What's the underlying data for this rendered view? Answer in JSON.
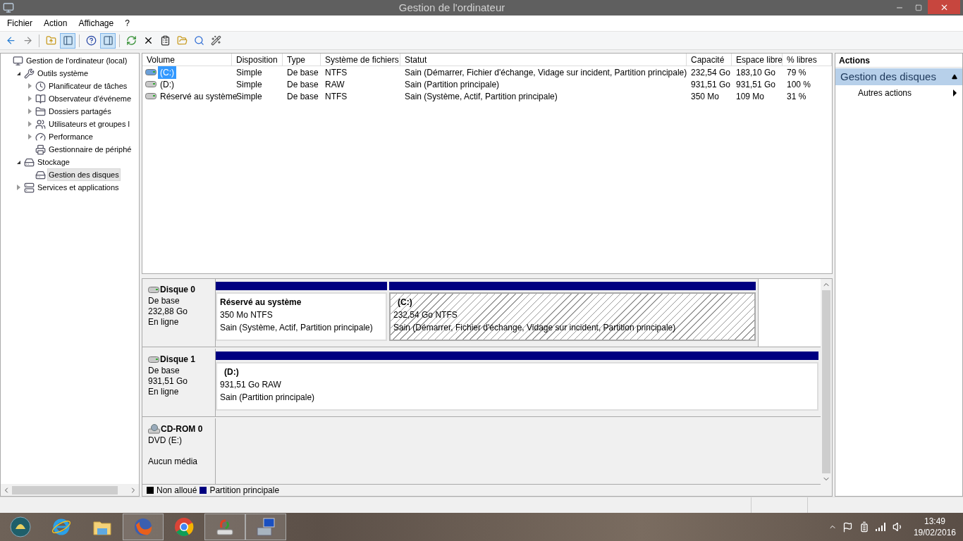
{
  "window": {
    "title": "Gestion de l'ordinateur"
  },
  "menu": [
    "Fichier",
    "Action",
    "Affichage",
    "?"
  ],
  "toolbar": [
    {
      "pressed": false
    },
    {
      "pressed": false
    },
    {
      "pressed": false
    },
    {
      "pressed": true
    },
    {
      "pressed": false
    },
    {
      "pressed": true
    },
    {
      "pressed": false
    },
    {
      "pressed": false
    },
    {
      "pressed": false
    },
    {
      "pressed": false
    },
    {
      "pressed": false
    },
    {
      "pressed": false
    }
  ],
  "tree": [
    {
      "label": "Gestion de l'ordinateur (local)",
      "selected": false,
      "children": [
        {
          "label": "Outils système",
          "expanded": true,
          "selected": false,
          "children": [
            {
              "label": "Planificateur de tâches",
              "expanded": false,
              "selected": false
            },
            {
              "label": "Observateur d'événeme",
              "expanded": false,
              "selected": false
            },
            {
              "label": "Dossiers partagés",
              "expanded": false,
              "selected": false
            },
            {
              "label": "Utilisateurs et groupes l",
              "expanded": false,
              "selected": false
            },
            {
              "label": "Performance",
              "expanded": false,
              "selected": false
            },
            {
              "label": "Gestionnaire de périphé",
              "selected": false
            }
          ]
        },
        {
          "label": "Stockage",
          "expanded": true,
          "selected": false,
          "children": [
            {
              "label": "Gestion des disques",
              "selected": true
            }
          ]
        },
        {
          "label": "Services et applications",
          "expanded": false,
          "selected": false
        }
      ]
    }
  ],
  "volumes": {
    "columns": [
      "Volume",
      "Disposition",
      "Type",
      "Système de fichiers",
      "Statut",
      "Capacité",
      "Espace libre",
      "% libres"
    ],
    "rows": [
      {
        "selected": true,
        "cells": [
          "(C:)",
          "Simple",
          "De base",
          "NTFS",
          "Sain (Démarrer, Fichier d'échange, Vidage sur incident, Partition principale)",
          "232,54 Go",
          "183,10 Go",
          "79 %"
        ]
      },
      {
        "selected": false,
        "cells": [
          "(D:)",
          "Simple",
          "De base",
          "RAW",
          "Sain (Partition principale)",
          "931,51 Go",
          "931,51 Go",
          "100 %"
        ]
      },
      {
        "selected": false,
        "cells": [
          "Réservé au système",
          "Simple",
          "De base",
          "NTFS",
          "Sain (Système, Actif, Partition principale)",
          "350 Mo",
          "109 Mo",
          "31 %"
        ]
      }
    ]
  },
  "disks": [
    {
      "kind": "disk",
      "name": "Disque 0",
      "lines": [
        "De base",
        "232,88 Go",
        "En ligne"
      ],
      "partitions": [
        {
          "name": "Réservé au système",
          "size": "350 Mo NTFS",
          "status": "Sain (Système, Actif, Partition principale)",
          "selected": false
        },
        {
          "name": "(C:)",
          "size": "232,54 Go NTFS",
          "status": "Sain (Démarrer, Fichier d'échange, Vidage sur incident, Partition principale)",
          "selected": true
        }
      ]
    },
    {
      "kind": "disk",
      "name": "Disque 1",
      "lines": [
        "De base",
        "931,51 Go",
        "En ligne"
      ],
      "partitions": [
        {
          "name": "(D:)",
          "size": "931,51 Go RAW",
          "status": "Sain (Partition principale)",
          "selected": false
        }
      ]
    },
    {
      "kind": "cdrom",
      "name": "CD-ROM 0",
      "lines": [
        "DVD (E:)"
      ],
      "note": "Aucun média"
    }
  ],
  "legend": [
    {
      "label": "Non alloué",
      "color": "#000000"
    },
    {
      "label": "Partition principale",
      "color": "#000080"
    }
  ],
  "actions": {
    "title": "Actions",
    "section": "Gestion des disques",
    "items": [
      "Autres actions"
    ]
  },
  "taskbar": {
    "apps": [
      {
        "running": false
      },
      {
        "running": false
      },
      {
        "running": false
      },
      {
        "running": true
      },
      {
        "running": false
      },
      {
        "running": true
      },
      {
        "running": true
      }
    ],
    "time": "13:49",
    "date": "19/02/2016"
  }
}
